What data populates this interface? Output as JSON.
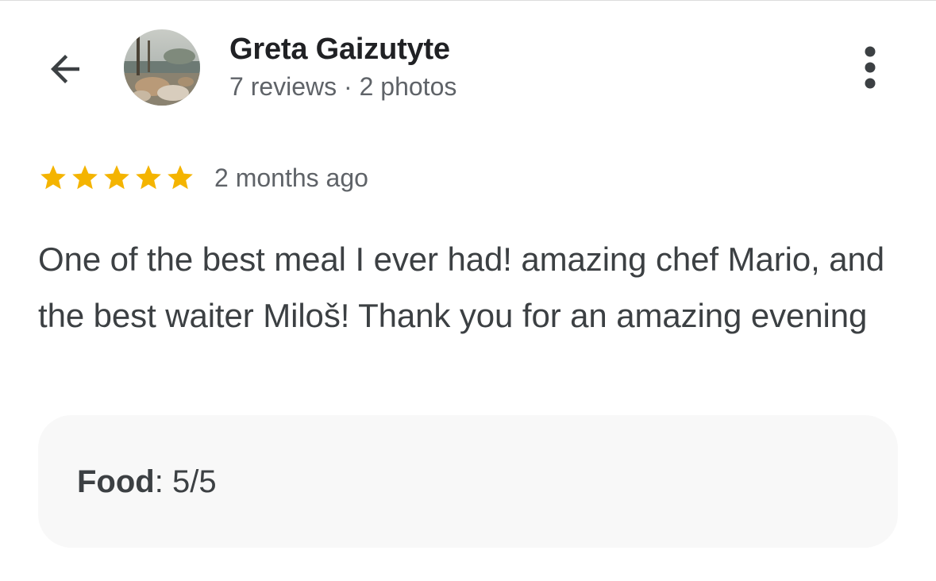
{
  "header": {
    "back_icon": "arrow-back-icon",
    "more_icon": "more-vert-icon"
  },
  "user": {
    "name": "Greta Gaizutyte",
    "meta": "7 reviews · 2 photos",
    "avatar_description": "profile photo"
  },
  "review": {
    "rating": 5,
    "max_rating": 5,
    "star_color": "#f4b400",
    "time_ago": "2 months ago",
    "text": "One of the best meal I ever had! amazing chef Mario, and the best waiter Miloš! Thank you for an amazing evening"
  },
  "attributes": [
    {
      "label": "Food",
      "separator": ": ",
      "value": "5/5"
    }
  ]
}
